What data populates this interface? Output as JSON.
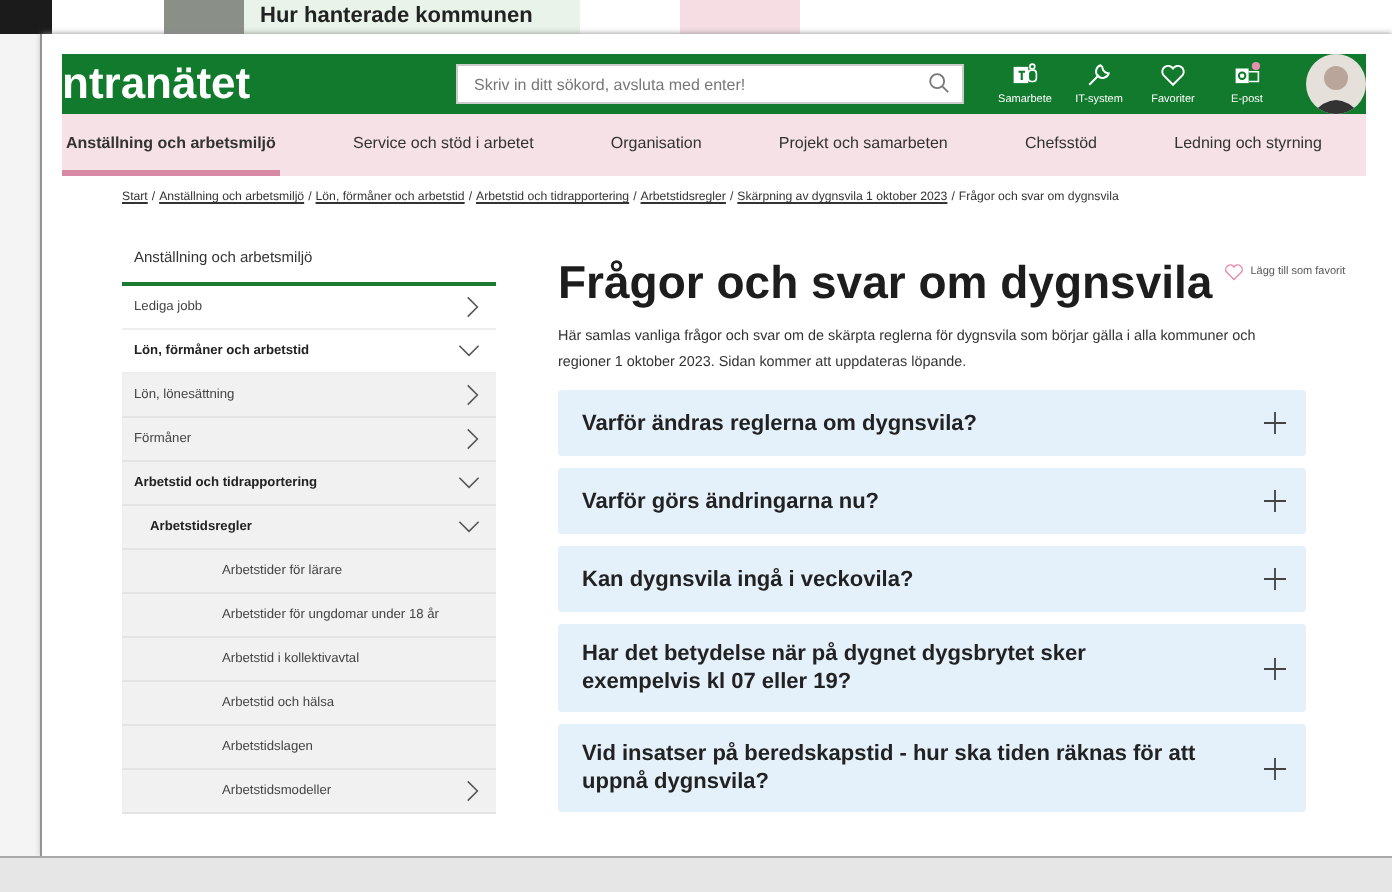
{
  "backdrop": {
    "headline": "Hur hanterade kommunen"
  },
  "header": {
    "logo": "ntranätet",
    "search": {
      "placeholder": "Skriv in ditt sökord, avsluta med enter!"
    },
    "shortcuts": [
      {
        "label": "Samarbete",
        "kind": "teams"
      },
      {
        "label": "IT-system",
        "kind": "wrench"
      },
      {
        "label": "Favoriter",
        "kind": "heart"
      },
      {
        "label": "E-post",
        "kind": "mail"
      }
    ]
  },
  "nav": [
    {
      "label": "Anställning och arbetsmiljö",
      "selected": true
    },
    {
      "label": "Service och stöd i arbetet",
      "selected": false
    },
    {
      "label": "Organisation",
      "selected": false
    },
    {
      "label": "Projekt och samarbeten",
      "selected": false
    },
    {
      "label": "Chefsstöd",
      "selected": false
    },
    {
      "label": "Ledning och styrning",
      "selected": false
    }
  ],
  "breadcrumb": [
    {
      "kind": "link",
      "label": "Start"
    },
    {
      "kind": "separator",
      "label": "/"
    },
    {
      "kind": "link",
      "label": "Anställning och arbetsmiljö"
    },
    {
      "kind": "separator",
      "label": "/"
    },
    {
      "kind": "link",
      "label": "Lön, förmåner och arbetstid"
    },
    {
      "kind": "separator",
      "label": "/"
    },
    {
      "kind": "link",
      "label": "Arbetstid och tidrapportering"
    },
    {
      "kind": "separator",
      "label": "/"
    },
    {
      "kind": "link",
      "label": "Arbetstidsregler"
    },
    {
      "kind": "separator",
      "label": "/"
    },
    {
      "kind": "link",
      "label": "Skärpning av dygnsvila 1 oktober 2023"
    },
    {
      "kind": "separator",
      "label": "/"
    },
    {
      "kind": "current",
      "label": "Frågor och svar om dygnsvila"
    }
  ],
  "sidebar": {
    "title": "Anställning och arbetsmiljö",
    "items": [
      {
        "label": "Lediga jobb",
        "expandable": true,
        "expanded": false
      },
      {
        "label": "Lön, förmåner och arbetstid",
        "expandable": true,
        "expanded": true,
        "children": [
          {
            "label": "Lön, lönesättning",
            "expandable": true,
            "expanded": false
          },
          {
            "label": "Förmåner",
            "expandable": true,
            "expanded": false
          },
          {
            "label": "Arbetstid och tidrapportering",
            "expandable": true,
            "expanded": true,
            "children": [
              {
                "label": "Arbetstidsregler",
                "expandable": true,
                "expanded": true,
                "children": [
                  {
                    "label": "Arbetstider för lärare",
                    "expandable": false,
                    "expanded": false
                  },
                  {
                    "label": "Arbetstider för ungdomar under 18 år",
                    "expandable": false,
                    "expanded": false
                  },
                  {
                    "label": "Arbetstid i kollektivavtal",
                    "expandable": false,
                    "expanded": false
                  },
                  {
                    "label": "Arbetstid och hälsa",
                    "expandable": false,
                    "expanded": false
                  },
                  {
                    "label": "Arbetstidslagen",
                    "expandable": false,
                    "expanded": false
                  },
                  {
                    "label": "Arbetstidsmodeller",
                    "expandable": true,
                    "expanded": false
                  }
                ]
              }
            ]
          }
        ]
      }
    ]
  },
  "page": {
    "title": "Frågor och svar om dygnsvila",
    "favorite": {
      "label": "Lägg till som favorit",
      "on": false
    },
    "intro": "Här samlas vanliga frågor och svar om de skärpta reglerna för dygnsvila som börjar gälla i alla kommuner och regioner 1 oktober 2023. Sidan kommer att uppdateras löpande.",
    "faq": [
      {
        "question": "Varför ändras reglerna om dygnsvila?",
        "expanded": false
      },
      {
        "question": "Varför görs ändringarna nu?",
        "expanded": false
      },
      {
        "question": "Kan dygnsvila ingå i veckovila?",
        "expanded": false
      },
      {
        "question": "Har det betydelse när på dygnet dygsbrytet sker exempelvis kl 07 eller 19?",
        "expanded": false
      },
      {
        "question": "Vid insatser på beredskapstid - hur ska tiden räknas för att uppnå dygnsvila?",
        "expanded": false
      }
    ]
  }
}
